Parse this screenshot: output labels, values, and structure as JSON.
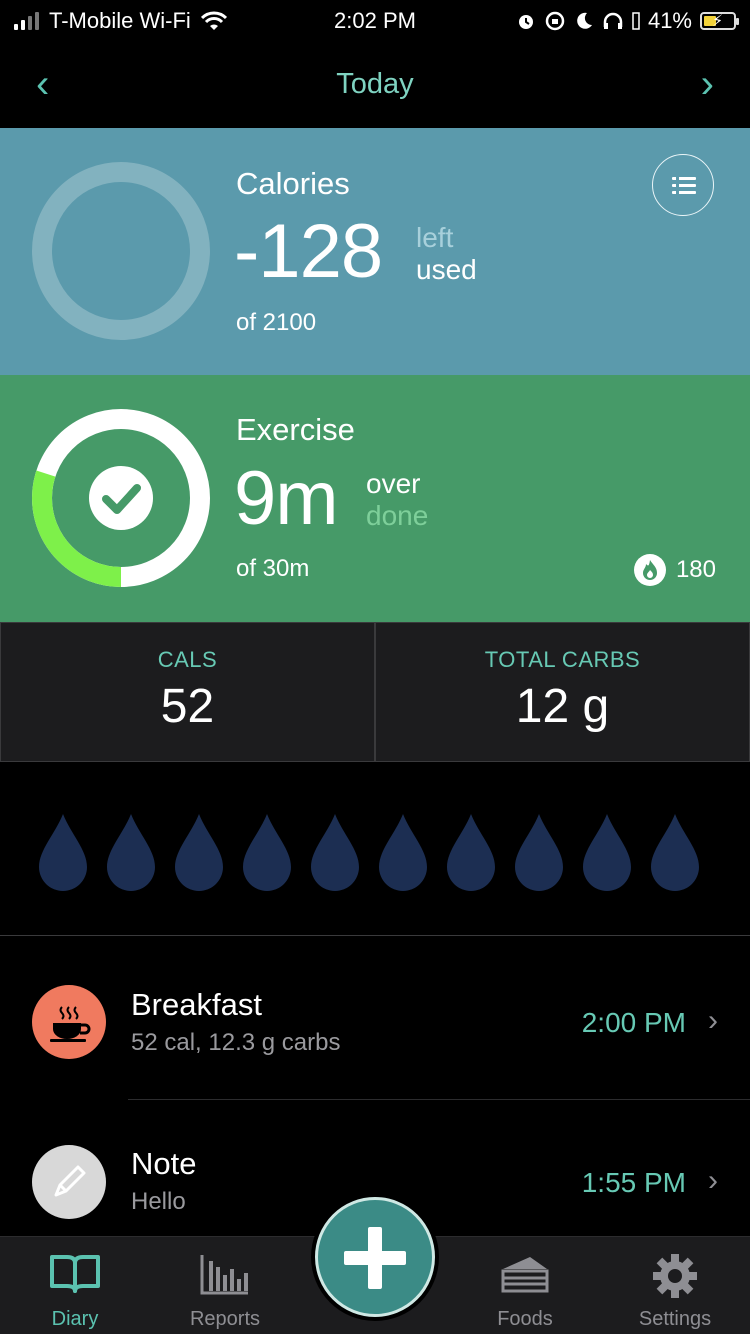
{
  "status": {
    "carrier": "T-Mobile Wi-Fi",
    "time": "2:02 PM",
    "battery": "41%",
    "icons": [
      "alarm-icon",
      "rotation-lock-icon",
      "moon-icon",
      "headphones-icon",
      "battery-icon"
    ]
  },
  "nav": {
    "title": "Today",
    "prev": "‹",
    "next": "›"
  },
  "calories": {
    "title": "Calories",
    "value": "-128",
    "label_left": "left",
    "label_used": "used",
    "of": "of 2100",
    "progress": 0
  },
  "exercise": {
    "title": "Exercise",
    "value": "9m",
    "label_over": "over",
    "label_done": "done",
    "of": "of 30m",
    "burned": "180",
    "progress": 0.3
  },
  "stats": [
    {
      "label": "CALS",
      "value": "52"
    },
    {
      "label": "TOTAL CARBS",
      "value": "12 g"
    }
  ],
  "water": {
    "drops_total": 10,
    "drops_filled": 0
  },
  "entries": [
    {
      "title": "Breakfast",
      "subtitle": "52 cal, 12.3 g carbs",
      "time": "2:00 PM",
      "icon": "coffee-cup-icon",
      "color": "#f07a5f"
    },
    {
      "title": "Note",
      "subtitle": "Hello",
      "time": "1:55 PM",
      "icon": "pencil-icon",
      "color": "#d8d8d8"
    }
  ],
  "tabs": [
    {
      "label": "Diary",
      "icon": "book-icon",
      "active": true
    },
    {
      "label": "Reports",
      "icon": "bar-chart-icon",
      "active": false
    },
    {
      "label": "Foods",
      "icon": "cake-slice-icon",
      "active": false
    },
    {
      "label": "Settings",
      "icon": "gear-icon",
      "active": false
    }
  ],
  "colors": {
    "accent": "#5bc2b0",
    "calories_bg": "#5b9aac",
    "exercise_bg": "#469a68",
    "exercise_ring": "#7ef04a",
    "drop": "#1c2e52",
    "breakfast_icon": "#f07a5f"
  }
}
